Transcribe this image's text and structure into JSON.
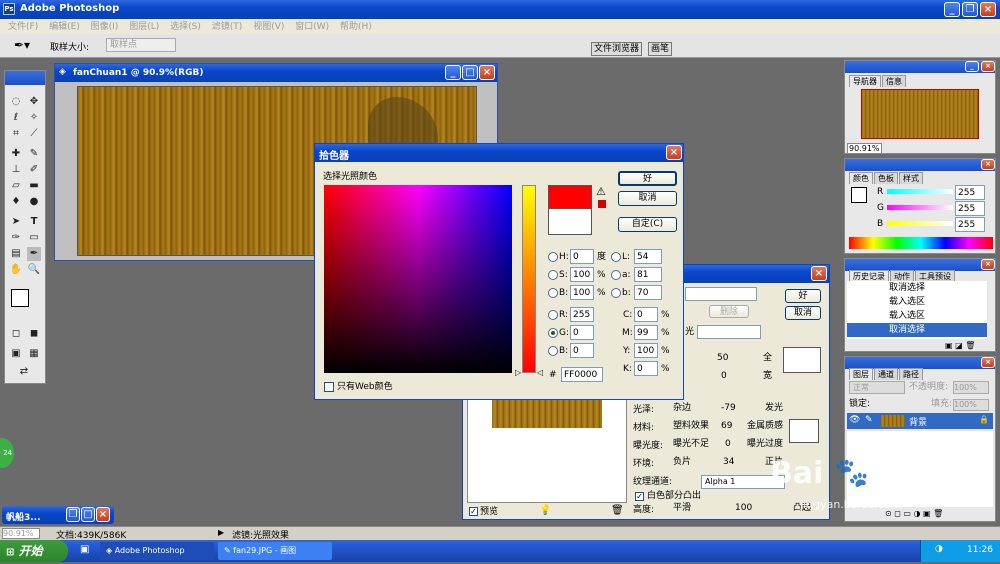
{
  "app": {
    "title": "Adobe Photoshop"
  },
  "menu": [
    "文件(F)",
    "编辑(E)",
    "图像(I)",
    "图层(L)",
    "选择(S)",
    "滤镜(T)",
    "视图(V)",
    "窗口(W)",
    "帮助(H)"
  ],
  "options": {
    "sample_size_label": "取样大小:",
    "sample_value": "取样点",
    "file_browser_tab": "文件浏览器",
    "brushes_tab": "画笔"
  },
  "document": {
    "title": "fanChuan1 @ 90.9%(RGB)"
  },
  "picker": {
    "title": "拾色器",
    "subtitle": "选择光照颜色",
    "ok": "好",
    "cancel": "取消",
    "custom": "自定(C)",
    "fields": {
      "H": {
        "label": "H:",
        "value": "0",
        "unit": "度"
      },
      "S": {
        "label": "S:",
        "value": "100",
        "unit": "%"
      },
      "B": {
        "label": "B:",
        "value": "100",
        "unit": "%"
      },
      "R": {
        "label": "R:",
        "value": "255"
      },
      "G": {
        "label": "G:",
        "value": "0"
      },
      "Bl": {
        "label": "B:",
        "value": "0"
      },
      "L": {
        "label": "L:",
        "value": "54"
      },
      "a": {
        "label": "a:",
        "value": "81"
      },
      "b": {
        "label": "b:",
        "value": "70"
      },
      "C": {
        "label": "C:",
        "value": "0",
        "unit": "%"
      },
      "M": {
        "label": "M:",
        "value": "99",
        "unit": "%"
      },
      "Y": {
        "label": "Y:",
        "value": "100",
        "unit": "%"
      },
      "K": {
        "label": "K:",
        "value": "0",
        "unit": "%"
      }
    },
    "hex_label": "#",
    "hex": "FF0000",
    "web_only": "只有Web颜色",
    "new_color": "#ff0000",
    "old_color": "#ffffff"
  },
  "lighting": {
    "ok": "好",
    "cancel": "取消",
    "delete": "删除",
    "light_type": "光",
    "intensity_value": "50",
    "full_label": "全",
    "focus_value": "0",
    "wide_label": "宽",
    "gloss_label": "光泽:",
    "gloss_left": "杂边",
    "gloss_value": "-79",
    "gloss_right": "发光",
    "material_label": "材料:",
    "material_left": "塑料效果",
    "material_value": "69",
    "material_right": "金属质感",
    "exposure_label": "曝光度:",
    "exposure_left": "曝光不足",
    "exposure_value": "0",
    "exposure_right": "曝光过度",
    "ambience_label": "环境:",
    "ambience_left": "负片",
    "ambience_value": "34",
    "ambience_right": "正片",
    "texture_label": "纹理通道:",
    "texture_value": "Alpha 1",
    "white_high_label": "白色部分凸出",
    "height_label": "高度:",
    "height_left": "平滑",
    "height_value": "100",
    "height_right": "凸起",
    "preview_label": "预览"
  },
  "navigator": {
    "tab1": "导航器",
    "tab2": "信息",
    "zoom": "90.91%"
  },
  "color_panel": {
    "tab1": "颜色",
    "tab2": "色板",
    "tab3": "样式",
    "R": "R",
    "G": "G",
    "B": "B",
    "r_val": "255",
    "g_val": "255",
    "b_val": "255"
  },
  "history": {
    "tab1": "历史记录",
    "tab2": "动作",
    "tab3": "工具预设",
    "items": [
      "取消选择",
      "载入选区",
      "载入选区",
      "取消选择"
    ]
  },
  "layers": {
    "tab1": "图层",
    "tab2": "通道",
    "tab3": "路径",
    "blend": "正常",
    "opacity_label": "不透明度:",
    "opacity": "100%",
    "lock_label": "锁定:",
    "fill_label": "填充:",
    "fill": "100%",
    "layer_name": "背景"
  },
  "status": {
    "zoom": "90.91%",
    "doc": "文档:439K/586K",
    "filter": "滤镜:光照效果"
  },
  "minimized": {
    "title": "帆船3..."
  },
  "badge": {
    "value": "24"
  },
  "taskbar": {
    "start": "开始",
    "item1": "Adobe Photoshop",
    "item2": "fan29.JPG - 画图",
    "clock": "11:26"
  },
  "watermark": {
    "brand": "Bai",
    "brand2": "经验",
    "url": "jingyan.baidu.com"
  }
}
